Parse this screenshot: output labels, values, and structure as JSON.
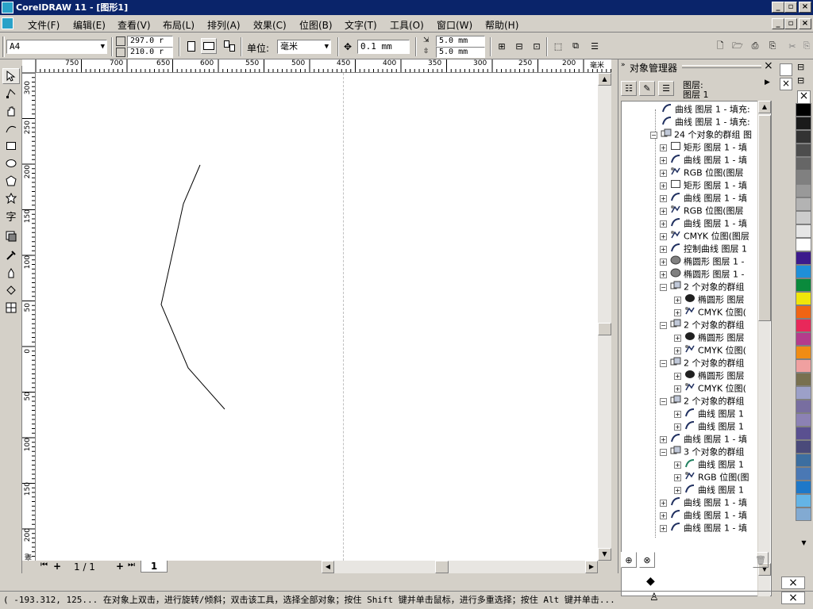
{
  "window": {
    "title": "CorelDRAW 11 - [图形1]"
  },
  "menu": [
    "文件(F)",
    "编辑(E)",
    "查看(V)",
    "布局(L)",
    "排列(A)",
    "效果(C)",
    "位图(B)",
    "文字(T)",
    "工具(O)",
    "窗口(W)",
    "帮助(H)"
  ],
  "toolbar": {
    "paper_size": "A4",
    "width": "297.0 r",
    "height": "210.0 r",
    "unit_label": "单位:",
    "unit_value": "毫米",
    "nudge": "0.1 mm",
    "dup_x": "5.0 mm",
    "dup_y": "5.0 mm"
  },
  "hruler": {
    "labels": [
      "750",
      "700",
      "650",
      "600",
      "550",
      "500",
      "450",
      "400",
      "350",
      "300",
      "250",
      "200",
      "毫米"
    ]
  },
  "vruler": {
    "labels": [
      "300",
      "250",
      "200",
      "150",
      "100",
      "50",
      "0",
      "50",
      "100",
      "150",
      "200",
      "毫米"
    ]
  },
  "pagebar": {
    "counter": "1 / 1",
    "tab": "1"
  },
  "docker": {
    "title": "对象管理器",
    "layer_line1": "图层:",
    "layer_line2": "图层  1",
    "tree": [
      {
        "indent": 0,
        "expand": "",
        "icon": "curve",
        "text": "曲线 图层 1 - 填充:"
      },
      {
        "indent": 0,
        "expand": "",
        "icon": "curve",
        "text": "曲线 图层 1 - 填充:"
      },
      {
        "indent": 0,
        "expand": "-",
        "icon": "group",
        "text": "24 个对象的群组 图"
      },
      {
        "indent": 1,
        "expand": "+",
        "icon": "rect",
        "text": "矩形 图层 1 - 填"
      },
      {
        "indent": 1,
        "expand": "+",
        "icon": "curve",
        "text": "曲线 图层 1 - 填"
      },
      {
        "indent": 1,
        "expand": "+",
        "icon": "bitmap",
        "text": "RGB 位图(图层"
      },
      {
        "indent": 1,
        "expand": "+",
        "icon": "rect",
        "text": "矩形 图层 1 - 填"
      },
      {
        "indent": 1,
        "expand": "+",
        "icon": "curve",
        "text": "曲线 图层 1 - 填"
      },
      {
        "indent": 1,
        "expand": "+",
        "icon": "bitmap",
        "text": "RGB 位图(图层"
      },
      {
        "indent": 1,
        "expand": "+",
        "icon": "curve",
        "text": "曲线 图层 1 - 填"
      },
      {
        "indent": 1,
        "expand": "+",
        "icon": "bitmap",
        "text": "CMYK 位图(图层"
      },
      {
        "indent": 1,
        "expand": "+",
        "icon": "curve",
        "text": "控制曲线 图层 1"
      },
      {
        "indent": 1,
        "expand": "+",
        "icon": "ellipse-grey",
        "text": "椭圆形 图层 1 -"
      },
      {
        "indent": 1,
        "expand": "+",
        "icon": "ellipse-grey",
        "text": "椭圆形 图层 1 -"
      },
      {
        "indent": 1,
        "expand": "-",
        "icon": "group",
        "text": "2 个对象的群组"
      },
      {
        "indent": 2,
        "expand": "+",
        "icon": "ellipse-black",
        "text": "椭圆形 图层"
      },
      {
        "indent": 2,
        "expand": "+",
        "icon": "bitmap",
        "text": "CMYK 位图("
      },
      {
        "indent": 1,
        "expand": "-",
        "icon": "group",
        "text": "2 个对象的群组"
      },
      {
        "indent": 2,
        "expand": "+",
        "icon": "ellipse-black",
        "text": "椭圆形 图层"
      },
      {
        "indent": 2,
        "expand": "+",
        "icon": "bitmap",
        "text": "CMYK 位图("
      },
      {
        "indent": 1,
        "expand": "-",
        "icon": "group",
        "text": "2 个对象的群组"
      },
      {
        "indent": 2,
        "expand": "+",
        "icon": "ellipse-black",
        "text": "椭圆形 图层"
      },
      {
        "indent": 2,
        "expand": "+",
        "icon": "bitmap",
        "text": "CMYK 位图("
      },
      {
        "indent": 1,
        "expand": "-",
        "icon": "group",
        "text": "2 个对象的群组"
      },
      {
        "indent": 2,
        "expand": "+",
        "icon": "curve",
        "text": "曲线 图层 1"
      },
      {
        "indent": 2,
        "expand": "+",
        "icon": "curve",
        "text": "曲线 图层 1"
      },
      {
        "indent": 1,
        "expand": "+",
        "icon": "curve",
        "text": "曲线 图层 1 - 填"
      },
      {
        "indent": 1,
        "expand": "-",
        "icon": "group",
        "text": "3 个对象的群组"
      },
      {
        "indent": 2,
        "expand": "+",
        "icon": "curve-green",
        "text": "曲线 图层 1"
      },
      {
        "indent": 2,
        "expand": "+",
        "icon": "bitmap",
        "text": "RGB 位图(图"
      },
      {
        "indent": 2,
        "expand": "+",
        "icon": "curve",
        "text": "曲线 图层 1"
      },
      {
        "indent": 1,
        "expand": "+",
        "icon": "curve",
        "text": "曲线 图层 1 - 填"
      },
      {
        "indent": 1,
        "expand": "+",
        "icon": "curve",
        "text": "曲线 图层 1 - 填"
      },
      {
        "indent": 1,
        "expand": "+",
        "icon": "curve",
        "text": "曲线 图层 1 - 填"
      }
    ]
  },
  "palette": [
    "#ffffff",
    "#000000",
    "#1a1a1a",
    "#333333",
    "#4d4d4d",
    "#666666",
    "#808080",
    "#999999",
    "#b3b3b3",
    "#cccccc",
    "#e6e6e6",
    "#ffffff",
    "#3c1a8c",
    "#1f8fd8",
    "#0a8a3c",
    "#f0e60a",
    "#f06414",
    "#e8285a",
    "#b43c8c",
    "#f08c14",
    "#f0a0a0",
    "#787050",
    "#9ca0c8",
    "#786ea0",
    "#8c82b4",
    "#5a5090",
    "#4a4a7a",
    "#3c6ea0",
    "#4a78b4",
    "#1e78c8",
    "#64b4e6",
    "#82aad2"
  ],
  "status": {
    "text": "( -193.312, 125...  在对象上双击，进行旋转/倾斜；双击该工具，选择全部对象；按住 Shift 键并单击鼠标，进行多重选择；按住 Alt 键并单击..."
  }
}
